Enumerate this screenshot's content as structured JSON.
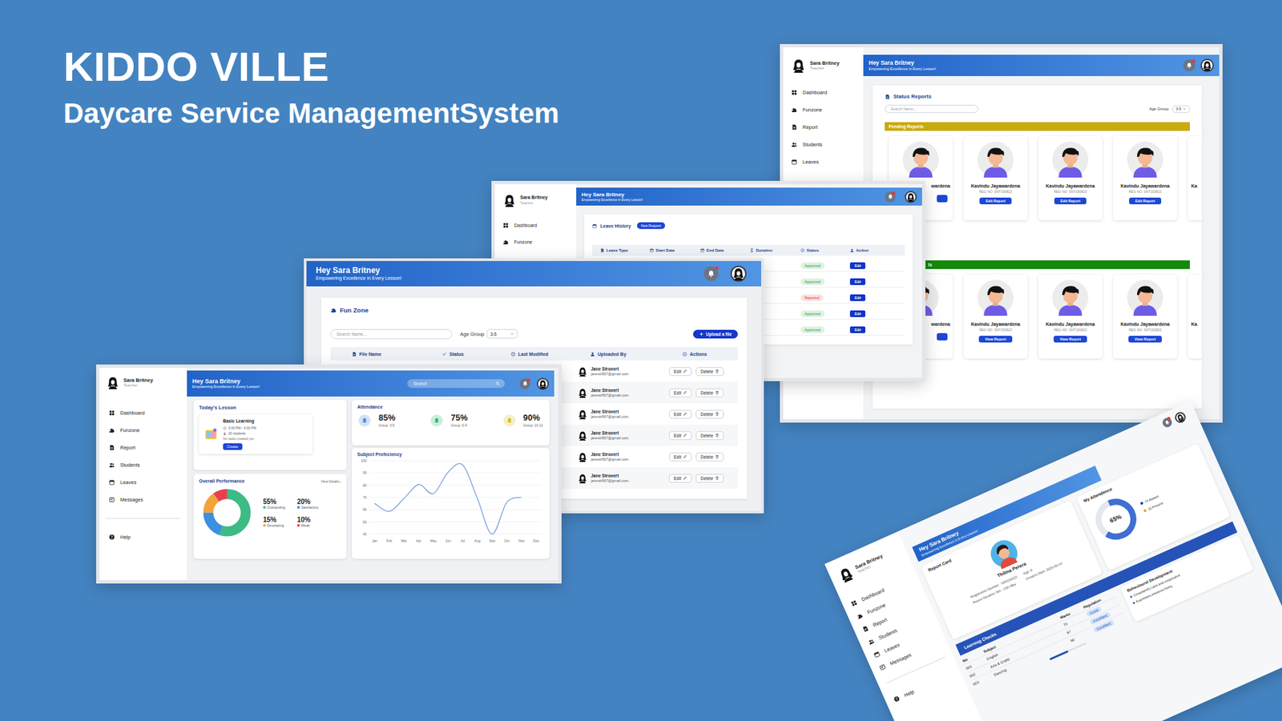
{
  "slide": {
    "title": "KIDDO VILLE",
    "subtitle": "Daycare Service ManagementSystem"
  },
  "status_window": {
    "user": {
      "name": "Sara Britney",
      "role": "Teacher"
    },
    "sidebar": [
      "Dashboard",
      "Funzone",
      "Report",
      "Students",
      "Leaves"
    ],
    "greeting": "Hey Sara Britney",
    "tagline": "Empowering Excellence in Every Lesson!",
    "panel_title": "Status Reports",
    "search_placeholder": "Search Name...",
    "age_label": "Age Group",
    "age_value": "3-5",
    "sections": [
      {
        "label": "Pending Reports",
        "kind": "whole",
        "color": "#c9ab0c",
        "cards": [
          {
            "kind": "cut-left",
            "name": "wardena"
          },
          {
            "kind": "full",
            "name": "Kavindu Jayawardena",
            "reg": "REG NO: SNT150823",
            "button": "Edit Report"
          },
          {
            "kind": "full",
            "name": "Kavindu Jayawardena",
            "reg": "REG NO: SNT150823",
            "button": "Edit Report"
          },
          {
            "kind": "full",
            "name": "Kavindu Jayawardena",
            "reg": "REG NO: SNT150823",
            "button": "Edit Report"
          },
          {
            "kind": "cut-right",
            "name": "Ka"
          }
        ]
      },
      {
        "label": "ts",
        "kind": "cut-left",
        "color": "#138a0c",
        "cards": [
          {
            "kind": "cut-left",
            "name": "wardena"
          },
          {
            "kind": "full",
            "name": "Kavindu Jayawardena",
            "reg": "REG NO: SNT150823",
            "button": "View Report"
          },
          {
            "kind": "full",
            "name": "Kavindu Jayawardena",
            "reg": "REG NO: SNT150823",
            "button": "View Report"
          },
          {
            "kind": "full",
            "name": "Kavindu Jayawardena",
            "reg": "REG NO: SNT150823",
            "button": "View Report"
          },
          {
            "kind": "cut-right",
            "name": "Ka"
          }
        ]
      }
    ]
  },
  "leave_window": {
    "user": {
      "name": "Sara Britney",
      "role": "Teacher"
    },
    "sidebar": [
      "Dashboard",
      "Funzone"
    ],
    "greeting": "Hey Sara Britney",
    "tagline": "Empowering Excellence in Every Lesson!",
    "panel_title": "Leave History",
    "new_request": "New Request",
    "columns": [
      "Leave Type",
      "Start Date",
      "End Date",
      "Duration",
      "Status",
      "Action"
    ],
    "rows": [
      {
        "status": "Approved",
        "color": "#2f9a45",
        "action": "Edit"
      },
      {
        "status": "Approved",
        "color": "#2f9a45",
        "action": "Edit"
      },
      {
        "status": "Rejected",
        "color": "#d9363e",
        "action": "Edit"
      },
      {
        "status": "Approved",
        "color": "#2f9a45",
        "action": "Edit"
      },
      {
        "status": "Approved",
        "color": "#2f9a45",
        "action": "Edit"
      }
    ]
  },
  "funzone_window": {
    "greeting": "Hey Sara Britney",
    "tagline": "Empowering Excellence in Every Lesson!",
    "title": "Fun Zone",
    "search_placeholder": "Search Name...",
    "age_label": "Age Group",
    "age_value": "3-5",
    "upload": "Upload a file",
    "columns": [
      "File Name",
      "Status",
      "Last Modified",
      "Uploaded By",
      "Actions"
    ],
    "rows": [
      {
        "name": "Jane Strovert",
        "email": "janestr567@gmail.com",
        "edit": "Edit",
        "delete": "Delete"
      },
      {
        "name": "Jane Strovert",
        "email": "janestr567@gmail.com",
        "edit": "Edit",
        "delete": "Delete"
      },
      {
        "name": "Jane Strovert",
        "email": "janestr567@gmail.com",
        "edit": "Edit",
        "delete": "Delete"
      },
      {
        "name": "Jane Strovert",
        "email": "janestr567@gmail.com",
        "edit": "Edit",
        "delete": "Delete"
      },
      {
        "name": "Jane Strovert",
        "email": "janestr567@gmail.com",
        "edit": "Edit",
        "delete": "Delete"
      },
      {
        "name": "Jane Strovert",
        "email": "janestr567@gmail.com",
        "edit": "Edit",
        "delete": "Delete"
      }
    ]
  },
  "dashboard_window": {
    "user": {
      "name": "Sara Britney",
      "role": "Teacher"
    },
    "sidebar": [
      "Dashboard",
      "Funzone",
      "Report",
      "Students",
      "Leaves",
      "Messages"
    ],
    "help": "Help",
    "greeting": "Hey Sara Britney",
    "tagline": "Empowering Excellence in Every Lesson!",
    "search_placeholder": "Search",
    "lesson": {
      "title": "Today's Lesson",
      "name": "Basic Learning",
      "time": "3.00 PM - 4.00 PM",
      "students": "20 students",
      "note": "No tasks created yet.",
      "button": "Create"
    },
    "attendance": {
      "title": "Attendance",
      "groups": [
        {
          "value": "85%",
          "label": "Group: 3-5",
          "color": "#4a8fdc"
        },
        {
          "value": "75%",
          "label": "Group: 6-9",
          "color": "#33b872"
        },
        {
          "value": "90%",
          "label": "Group: 10-12",
          "color": "#d8bf2a"
        }
      ]
    },
    "performance": {
      "title": "Overall Performance",
      "link": "View Details ›",
      "segments": [
        {
          "value": 55,
          "pct": "55%",
          "label": "Outstanding",
          "color": "#3dbb84"
        },
        {
          "value": 20,
          "pct": "20%",
          "label": "Satisfactory",
          "color": "#3d8fe0"
        },
        {
          "value": 15,
          "pct": "15%",
          "label": "Developing",
          "color": "#f2a33a"
        },
        {
          "value": 10,
          "pct": "10%",
          "label": "Weak",
          "color": "#e8414d"
        }
      ]
    },
    "chart": {
      "title": "Subject Profeciency",
      "y_ticks": [
        "100",
        "90",
        "80",
        "70",
        "60",
        "50",
        "40"
      ],
      "x_labels": [
        "Jan",
        "Feb",
        "Mar",
        "Apr",
        "May",
        "Jun",
        "Jul",
        "Aug",
        "Sep",
        "Oct",
        "Nov",
        "Dec"
      ],
      "series": [
        {
          "values": [
            65,
            58.5,
            69,
            80.5,
            73,
            90.5,
            96.5,
            69,
            40,
            66,
            70
          ]
        }
      ]
    }
  },
  "report_window": {
    "user": {
      "name": "Sara Britney",
      "role": "Teacher"
    },
    "sidebar": [
      "Dashboard",
      "Funzone",
      "Report",
      "Students",
      "Leaves",
      "Messages"
    ],
    "help": "Help",
    "greeting": "Hey Sara Britney",
    "tagline": "Empowering Excellence in Every Lesson!",
    "report_card": {
      "title": "Report Card",
      "name": "Thilina Perera",
      "reg": "Registration Number : SR0150221",
      "age": "Age: 6",
      "duration": "Report Duration: 6th - 13th May",
      "created": "Creation Date: 2025-05-14"
    },
    "attendance": {
      "title": "My Attendence",
      "value": "65%",
      "level": 0.65,
      "legend": [
        {
          "label": "73 Absent",
          "color": "#1f3c88"
        },
        {
          "label": "32 Present",
          "color": "#f29a2e"
        }
      ]
    },
    "learning": {
      "title": "Learning Checks",
      "columns": [
        "No",
        "Subject",
        "Marks",
        "Regulation"
      ],
      "rows": [
        [
          "001",
          "English",
          "70",
          "Good"
        ],
        [
          "002",
          "Arts & Crafts",
          "87",
          "Excellent"
        ],
        [
          "003",
          "Dancing",
          "90",
          "Excellent"
        ]
      ],
      "progress_level": 0.5
    },
    "behaviour": {
      "title": "Behavioural Development",
      "items": [
        "Consistently calm and cooperative",
        "Expresses emotions freely"
      ]
    }
  }
}
